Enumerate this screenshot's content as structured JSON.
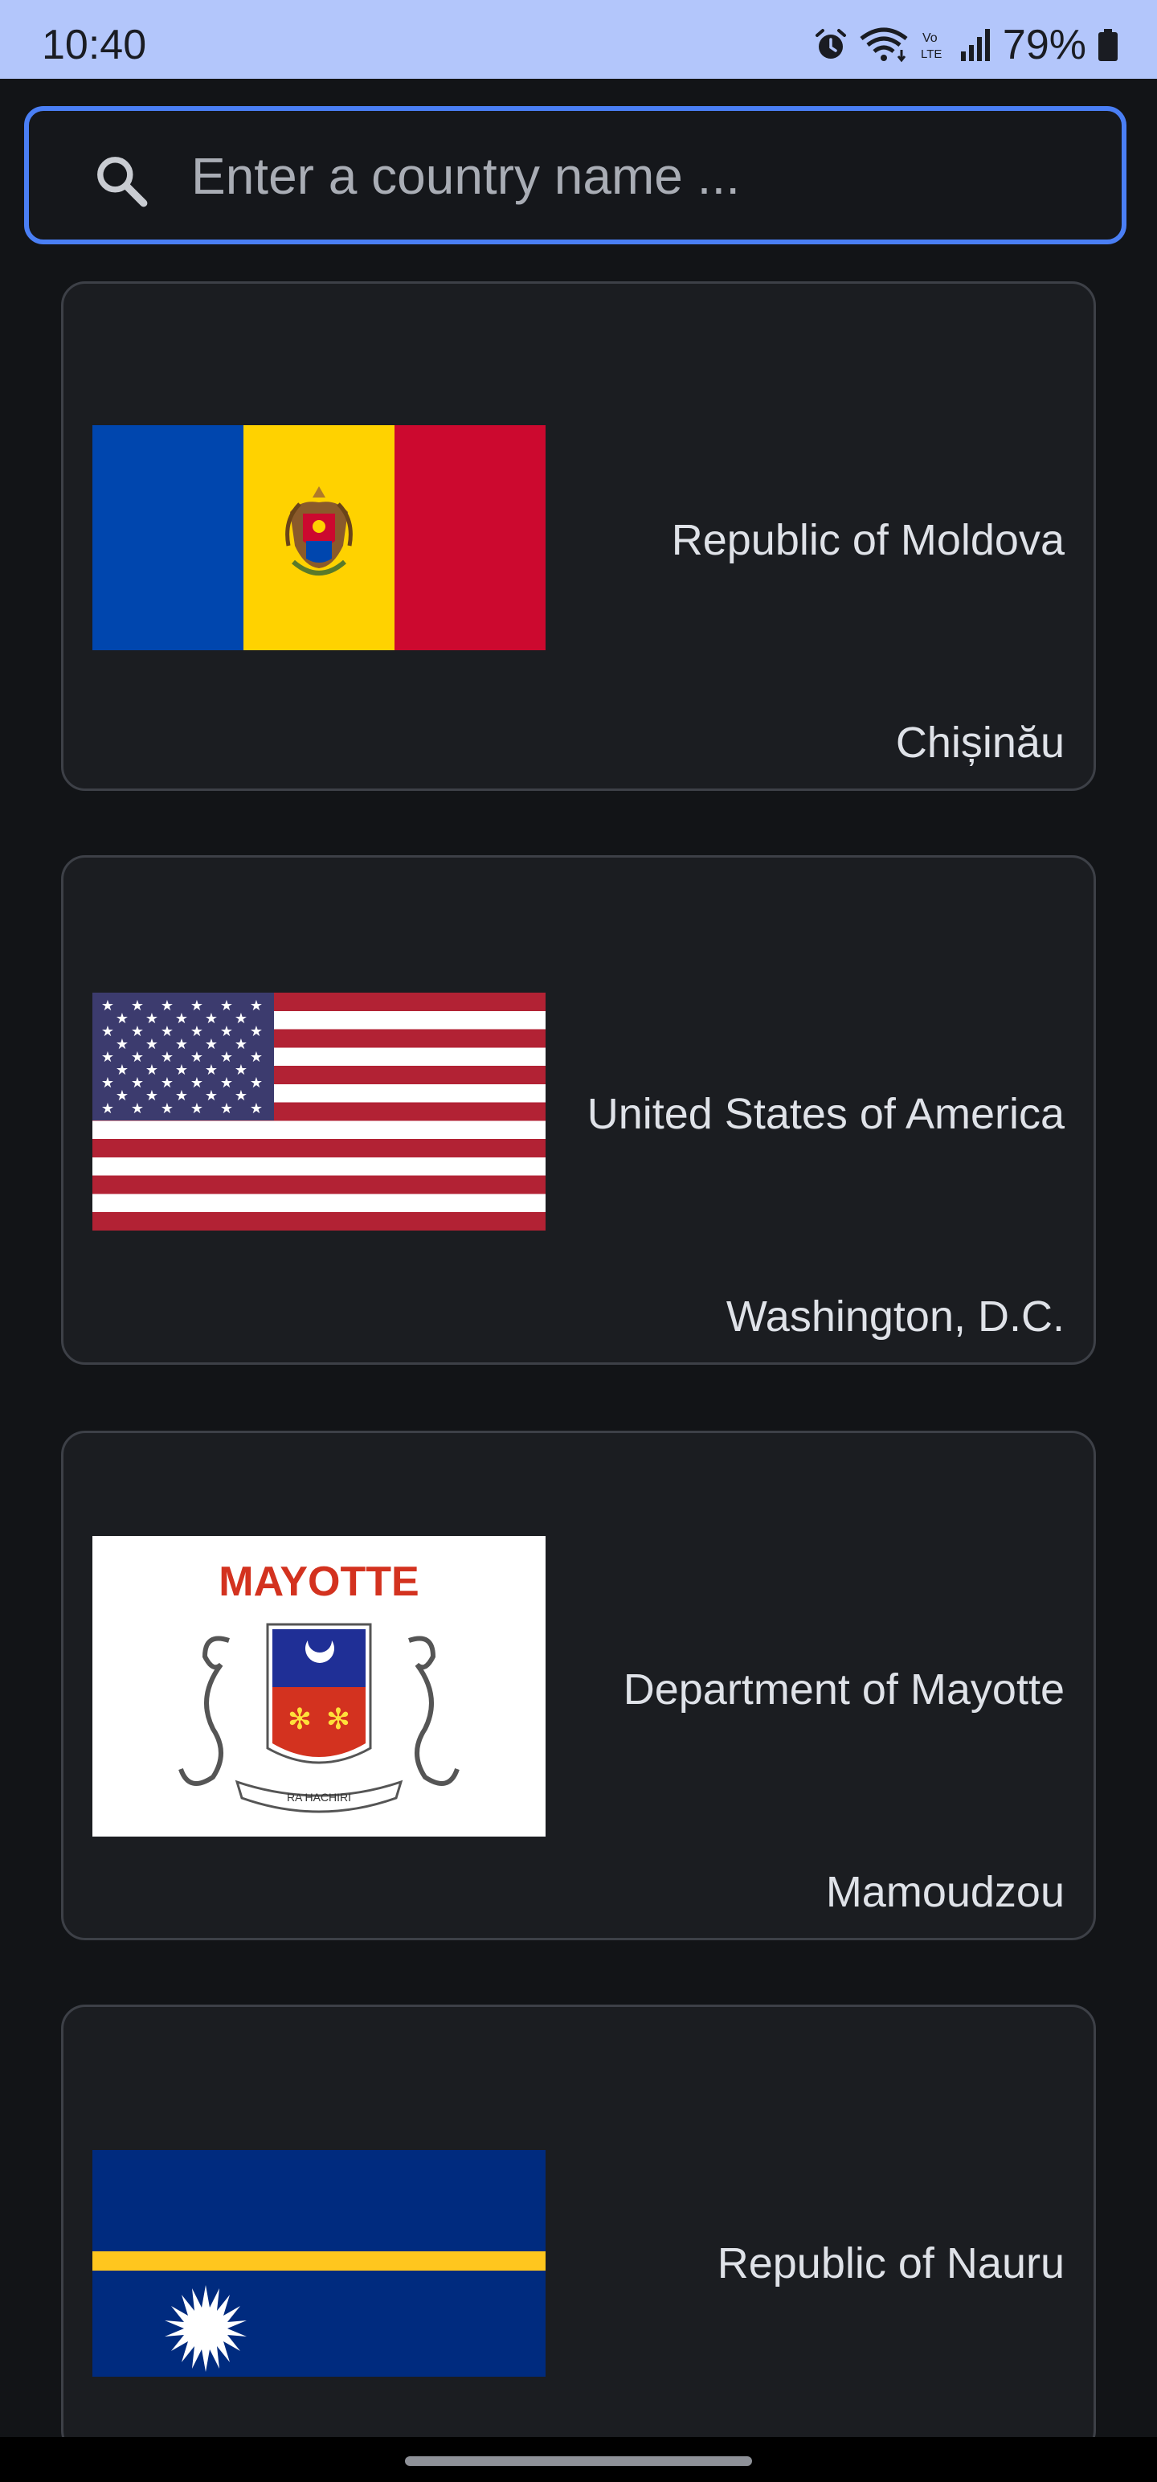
{
  "status_bar": {
    "time": "10:40",
    "battery": "79%",
    "icons": [
      "alarm-icon",
      "wifi-icon",
      "volte-icon",
      "signal-icon",
      "battery-icon"
    ]
  },
  "search": {
    "placeholder": "Enter a country name ...",
    "value": "",
    "icon": "search-icon"
  },
  "countries": [
    {
      "name": "Republic of Moldova",
      "capital": "Chișinău",
      "flag": "moldova-flag"
    },
    {
      "name": "United States of America",
      "capital": "Washington, D.C.",
      "flag": "usa-flag"
    },
    {
      "name": "Department of Mayotte",
      "capital": "Mamoudzou",
      "flag": "mayotte-flag",
      "flag_text": "MAYOTTE",
      "flag_motto": "RA HACHIRI"
    },
    {
      "name": "Republic of Nauru",
      "capital": "",
      "flag": "nauru-flag"
    }
  ],
  "colors": {
    "background": "#121417",
    "card": "#1b1d21",
    "card_border": "#3d4047",
    "accent": "#4a7ff5",
    "status_bar": "#b3c6fb",
    "text": "#dfe2e8"
  }
}
